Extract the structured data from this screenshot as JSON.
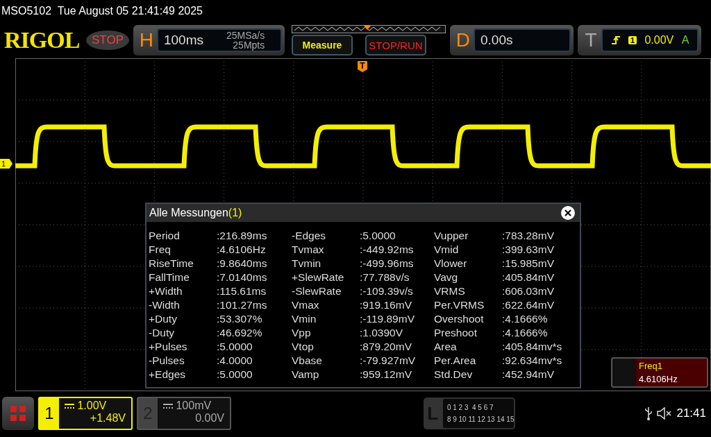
{
  "device": {
    "model": "MSO5102",
    "datetime": "Tue August 05 21:41:49 2025"
  },
  "header": {
    "logo": "RIGOL",
    "run_state": "STOP",
    "horizontal": {
      "label": "H",
      "timebase": "100ms",
      "sample_rate": "25MSa/s",
      "memory_depth": "25Mpts"
    },
    "buttons": [
      {
        "label": "Measure",
        "kind": "measure"
      },
      {
        "label": "STOP/RUN",
        "kind": "run"
      }
    ],
    "delay": {
      "label": "D",
      "value": "0.00s"
    },
    "trigger": {
      "label": "T",
      "source": "1",
      "level": "0.00V",
      "mode": "A"
    }
  },
  "plot": {
    "trigger_marker": "T",
    "channel_marker": "1"
  },
  "measurements": {
    "title": "Alle Messungen",
    "count": "(1)",
    "rows": [
      [
        {
          "name": "Period",
          "value": ":216.89ms"
        },
        {
          "name": "-Edges",
          "value": ":5.0000"
        },
        {
          "name": "Vupper",
          "value": ":783.28mV"
        }
      ],
      [
        {
          "name": "Freq",
          "value": ":4.6106Hz"
        },
        {
          "name": "Tvmax",
          "value": ":-449.92ms"
        },
        {
          "name": "Vmid",
          "value": ":399.63mV"
        }
      ],
      [
        {
          "name": "RiseTime",
          "value": ":9.8640ms"
        },
        {
          "name": "Tvmin",
          "value": ":-499.96ms"
        },
        {
          "name": "Vlower",
          "value": ":15.985mV"
        }
      ],
      [
        {
          "name": "FallTime",
          "value": ":7.0140ms"
        },
        {
          "name": "+SlewRate",
          "value": ":77.788v/s"
        },
        {
          "name": "Vavg",
          "value": ":405.84mV"
        }
      ],
      [
        {
          "name": "+Width",
          "value": ":115.61ms"
        },
        {
          "name": "-SlewRate",
          "value": ":-109.39v/s"
        },
        {
          "name": "VRMS",
          "value": ":606.03mV"
        }
      ],
      [
        {
          "name": "-Width",
          "value": ":101.27ms"
        },
        {
          "name": "Vmax",
          "value": ":919.16mV"
        },
        {
          "name": "Per.VRMS",
          "value": ":622.64mV"
        }
      ],
      [
        {
          "name": "+Duty",
          "value": ":53.307%"
        },
        {
          "name": "Vmin",
          "value": ":-119.89mV"
        },
        {
          "name": "Overshoot",
          "value": ":4.1666%"
        }
      ],
      [
        {
          "name": "-Duty",
          "value": ":46.692%"
        },
        {
          "name": "Vpp",
          "value": ":1.0390V"
        },
        {
          "name": "Preshoot",
          "value": ":4.1666%"
        }
      ],
      [
        {
          "name": "+Pulses",
          "value": ":5.0000"
        },
        {
          "name": "Vtop",
          "value": ":879.20mV"
        },
        {
          "name": "Area",
          "value": ":405.84mv*s"
        }
      ],
      [
        {
          "name": "-Pulses",
          "value": ":4.0000"
        },
        {
          "name": "Vbase",
          "value": ":-79.927mV"
        },
        {
          "name": "Per.Area",
          "value": ":92.634mv*s"
        }
      ],
      [
        {
          "name": "+Edges",
          "value": ":5.0000"
        },
        {
          "name": "Vamp",
          "value": ":959.12mV"
        },
        {
          "name": "Std.Dev",
          "value": ":452.94mV"
        }
      ]
    ]
  },
  "freq_readout": {
    "name": "Freq1",
    "value": "4.6106Hz"
  },
  "channels": [
    {
      "number": "1",
      "scale": "1.00V",
      "offset": "+1.48V",
      "selected": true
    },
    {
      "number": "2",
      "scale": "100mV",
      "offset": "0.00V",
      "selected": false
    }
  ],
  "logic": {
    "label": "L",
    "rows": [
      "0 1 2 3  4 5 6 7",
      "8 9 10 11 12 13 14 15"
    ]
  },
  "status": {
    "time": "21:41"
  }
}
